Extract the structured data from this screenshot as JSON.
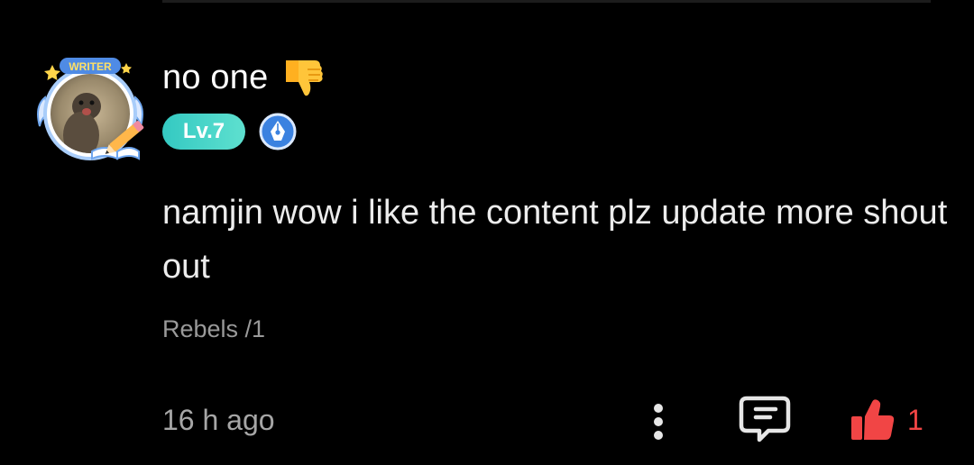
{
  "comment": {
    "username": "no one",
    "avatar_ribbon_text": "WRITER",
    "level": "Lv.7",
    "text": "namjin wow i like the content plz update more shout out",
    "source": "Rebels /1",
    "time": "16 h ago",
    "like_count": "1",
    "liked": true
  },
  "icons": {
    "username_emoji": "thumbs-down-icon",
    "badge": "pen-nib-icon",
    "more": "more-vertical-icon",
    "reply": "reply-comment-icon",
    "like": "thumbs-up-icon"
  },
  "colors": {
    "background": "#000000",
    "level_badge": "#3fd2c8",
    "like_active": "#f14545",
    "pen_badge": "#3b82e0",
    "muted_text": "#a6a6a6"
  }
}
